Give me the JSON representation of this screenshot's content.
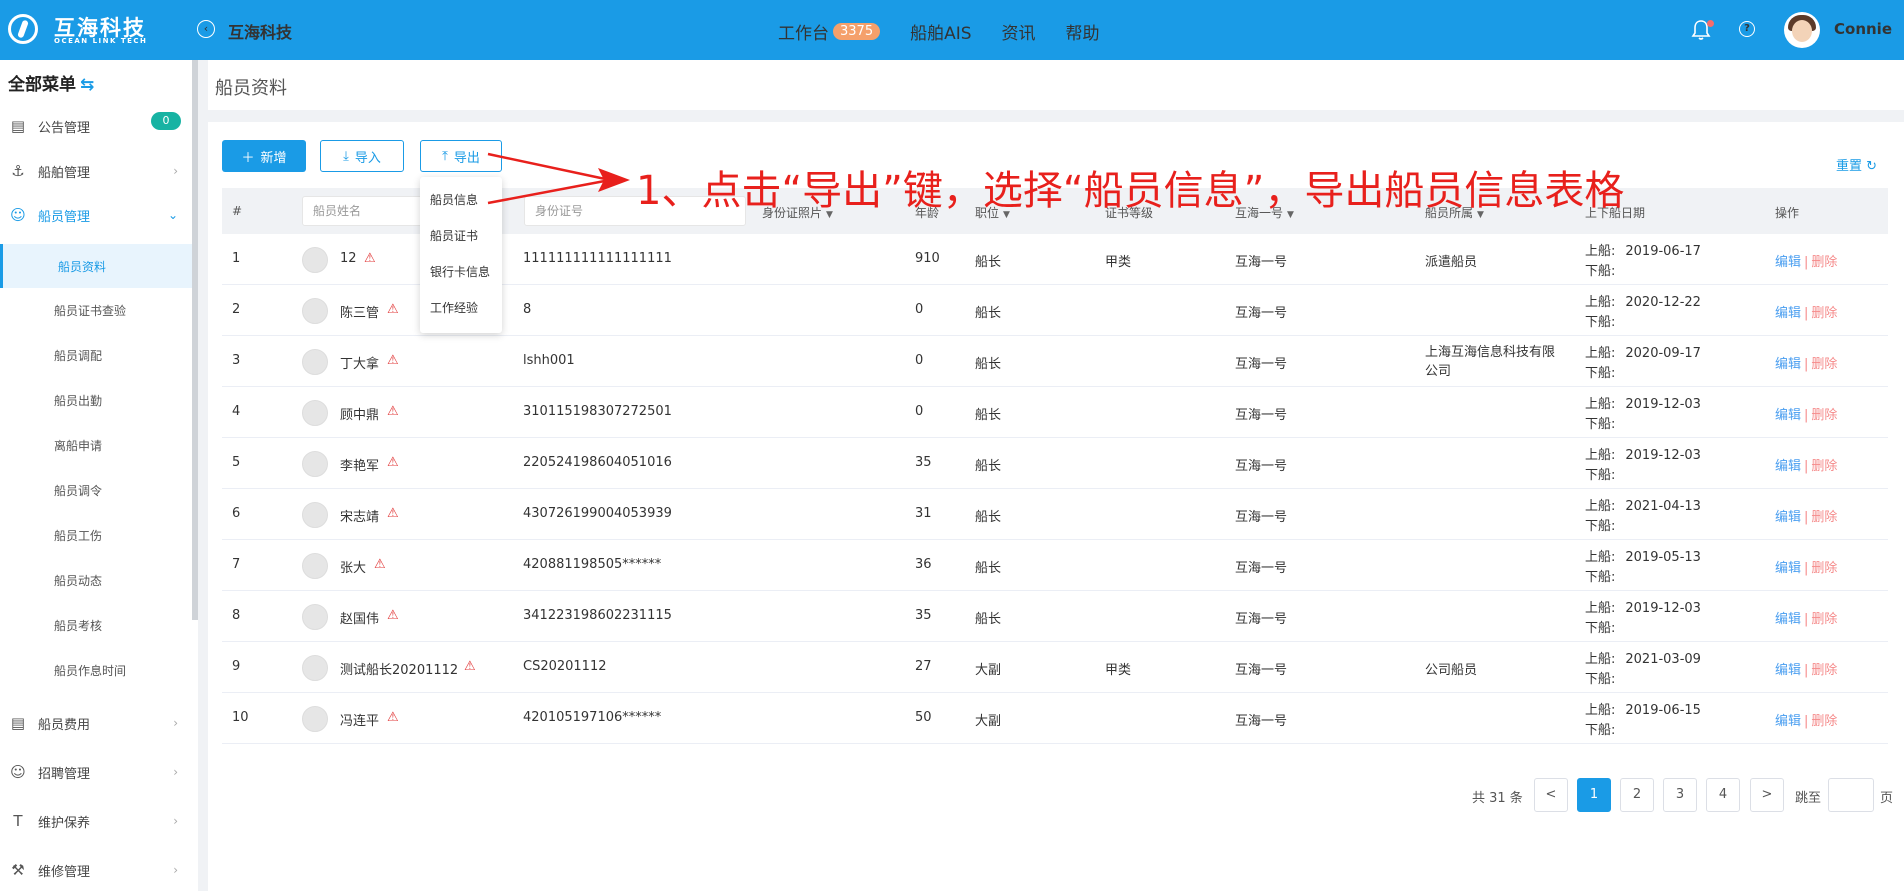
{
  "header": {
    "logo_cn": "互海科技",
    "logo_en": "OCEAN LINK TECH",
    "company": "互海科技",
    "nav": [
      {
        "label": "工作台",
        "badge": "3375"
      },
      {
        "label": "船舶AIS"
      },
      {
        "label": "资讯"
      },
      {
        "label": "帮助"
      }
    ],
    "user": "Connie"
  },
  "sidebar": {
    "title": "全部菜单",
    "items": [
      {
        "label": "公告管理",
        "icon": "book-icon",
        "badge": "0"
      },
      {
        "label": "船舶管理",
        "icon": "anchor-icon"
      },
      {
        "label": "船员管理",
        "icon": "user-icon"
      }
    ],
    "sub_items": [
      "船员资料",
      "船员证书查验",
      "船员调配",
      "船员出勤",
      "离船申请",
      "船员调令",
      "船员工伤",
      "船员动态",
      "船员考核",
      "船员作息时间"
    ],
    "items_after": [
      {
        "label": "船员费用",
        "icon": "wallet-icon"
      },
      {
        "label": "招聘管理",
        "icon": "user-search-icon"
      },
      {
        "label": "维护保养",
        "icon": "hammer-icon"
      },
      {
        "label": "维修管理",
        "icon": "wrench-icon"
      }
    ]
  },
  "page": {
    "title": "船员资料",
    "buttons": {
      "add": "新增",
      "import": "导入",
      "export": "导出"
    },
    "reset": "重置",
    "export_menu": [
      "船员信息",
      "船员证书",
      "银行卡信息",
      "工作经验"
    ],
    "annotation": "1、点击“导出”键，选择“船员信息”，导出船员信息表格"
  },
  "table": {
    "headers": {
      "index": "#",
      "name_placeholder": "船员姓名",
      "id_placeholder": "身份证号",
      "id_photo": "身份证照片",
      "age": "年龄",
      "position": "职位",
      "cert_level": "证书等级",
      "ship": "互海一号",
      "belong": "船员所属",
      "dates": "上下船日期",
      "actions": "操作"
    },
    "on_label": "上船:",
    "off_label": "下船:",
    "edit": "编辑",
    "delete": "删除",
    "rows": [
      {
        "no": "1",
        "name": "12",
        "id": "111111111111111111",
        "age": "910",
        "position": "船长",
        "cert": "甲类",
        "ship": "互海一号",
        "belong": "派遣船员",
        "on": "2019-06-17"
      },
      {
        "no": "2",
        "name": "陈三管",
        "id": "8",
        "age": "0",
        "position": "船长",
        "cert": "",
        "ship": "互海一号",
        "belong": "",
        "on": "2020-12-22"
      },
      {
        "no": "3",
        "name": "丁大拿",
        "id": "lshh001",
        "age": "0",
        "position": "船长",
        "cert": "",
        "ship": "互海一号",
        "belong": "上海互海信息科技有限",
        "belong2": "公司",
        "on": "2020-09-17"
      },
      {
        "no": "4",
        "name": "顾中鼎",
        "id": "310115198307272501",
        "age": "0",
        "position": "船长",
        "cert": "",
        "ship": "互海一号",
        "belong": "",
        "on": "2019-12-03"
      },
      {
        "no": "5",
        "name": "李艳军",
        "id": "220524198604051016",
        "age": "35",
        "position": "船长",
        "cert": "",
        "ship": "互海一号",
        "belong": "",
        "on": "2019-12-03"
      },
      {
        "no": "6",
        "name": "宋志靖",
        "id": "430726199004053939",
        "age": "31",
        "position": "船长",
        "cert": "",
        "ship": "互海一号",
        "belong": "",
        "on": "2021-04-13"
      },
      {
        "no": "7",
        "name": "张大",
        "id": "420881198505******",
        "age": "36",
        "position": "船长",
        "cert": "",
        "ship": "互海一号",
        "belong": "",
        "on": "2019-05-13"
      },
      {
        "no": "8",
        "name": "赵国伟",
        "id": "341223198602231115",
        "age": "35",
        "position": "船长",
        "cert": "",
        "ship": "互海一号",
        "belong": "",
        "on": "2019-12-03"
      },
      {
        "no": "9",
        "name": "测试船长20201112",
        "id": "CS20201112",
        "age": "27",
        "position": "大副",
        "cert": "甲类",
        "ship": "互海一号",
        "belong": "公司船员",
        "on": "2021-03-09"
      },
      {
        "no": "10",
        "name": "冯连平",
        "id": "420105197106******",
        "age": "50",
        "position": "大副",
        "cert": "",
        "ship": "互海一号",
        "belong": "",
        "on": "2019-06-15"
      }
    ]
  },
  "pagination": {
    "total": "共 31 条",
    "prev": "<",
    "pages": [
      "1",
      "2",
      "3",
      "4"
    ],
    "next": ">",
    "jump_label": "跳至",
    "page_label": "页"
  }
}
